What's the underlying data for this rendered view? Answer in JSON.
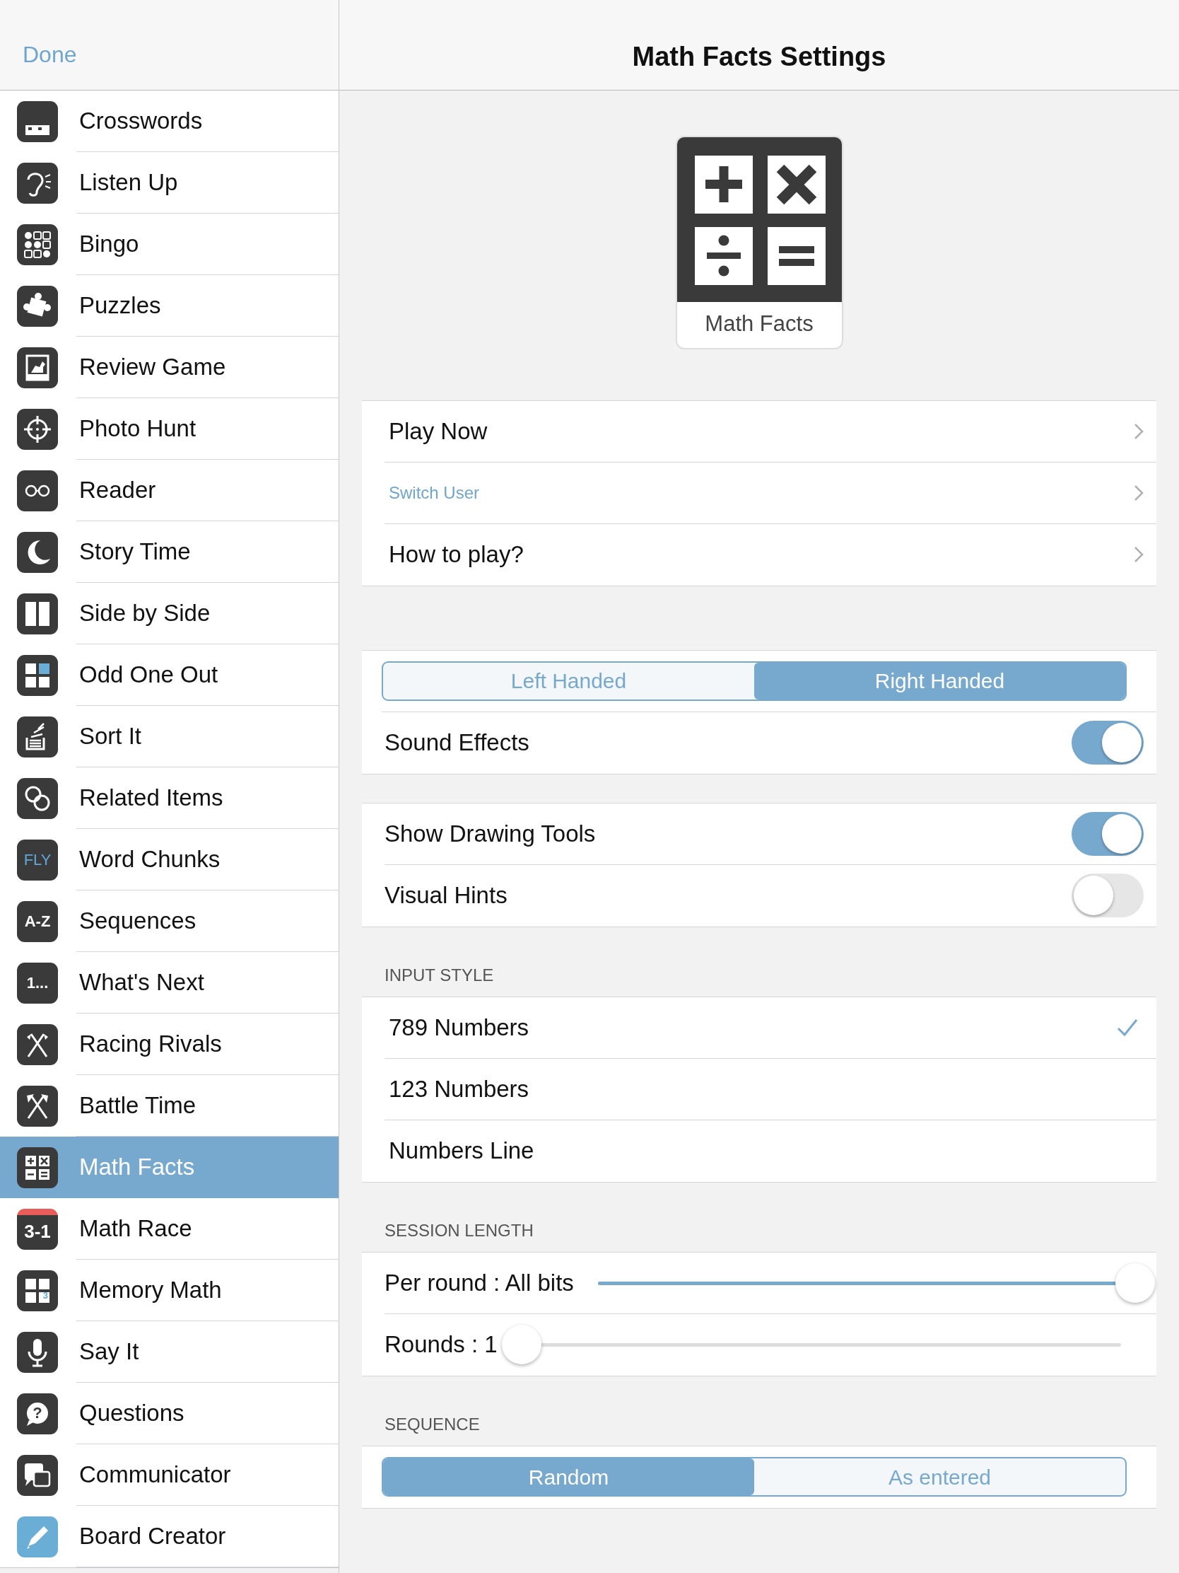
{
  "sidebar": {
    "done_button": "Done",
    "items": [
      {
        "label": "Crosswords",
        "selected": false
      },
      {
        "label": "Listen Up",
        "selected": false
      },
      {
        "label": "Bingo",
        "selected": false
      },
      {
        "label": "Puzzles",
        "selected": false
      },
      {
        "label": "Review Game",
        "selected": false
      },
      {
        "label": "Photo Hunt",
        "selected": false
      },
      {
        "label": "Reader",
        "selected": false
      },
      {
        "label": "Story Time",
        "selected": false
      },
      {
        "label": "Side by Side",
        "selected": false
      },
      {
        "label": "Odd One Out",
        "selected": false
      },
      {
        "label": "Sort It",
        "selected": false
      },
      {
        "label": "Related Items",
        "selected": false
      },
      {
        "label": "Word Chunks",
        "selected": false,
        "icon_text": "FLY"
      },
      {
        "label": "Sequences",
        "selected": false,
        "icon_text": "A-Z"
      },
      {
        "label": "What's Next",
        "selected": false,
        "icon_text": "1..."
      },
      {
        "label": "Racing Rivals",
        "selected": false
      },
      {
        "label": "Battle Time",
        "selected": false
      },
      {
        "label": "Math Facts",
        "selected": true
      },
      {
        "label": "Math Race",
        "selected": false,
        "icon_text": "3-1"
      },
      {
        "label": "Memory Math",
        "selected": false,
        "icon_text": "3"
      },
      {
        "label": "Say It",
        "selected": false
      },
      {
        "label": "Questions",
        "selected": false,
        "icon_text": "?"
      },
      {
        "label": "Communicator",
        "selected": false
      },
      {
        "label": "Board Creator",
        "selected": false
      }
    ]
  },
  "header": {
    "title": "Math Facts Settings"
  },
  "app_tile": {
    "label": "Math Facts"
  },
  "actions": [
    {
      "label": "Play Now",
      "kind": "primary"
    },
    {
      "label": "Switch User",
      "kind": "link"
    },
    {
      "label": "How to play?",
      "kind": "primary"
    }
  ],
  "hand_segment": [
    {
      "label": "Left Handed",
      "selected": false
    },
    {
      "label": "Right Handed",
      "selected": true
    }
  ],
  "sound_effects": {
    "label": "Sound Effects",
    "on": true
  },
  "drawing_switches": [
    {
      "label": "Show Drawing Tools",
      "on": true
    },
    {
      "label": "Visual Hints",
      "on": false
    }
  ],
  "input_style": {
    "heading": "INPUT STYLE",
    "options": [
      {
        "label": "789 Numbers",
        "selected": true
      },
      {
        "label": "123 Numbers",
        "selected": false
      },
      {
        "label": "Numbers Line",
        "selected": false
      }
    ]
  },
  "session_length": {
    "heading": "SESSION LENGTH",
    "sliders": [
      {
        "label": "Per round : All bits",
        "level": 1
      },
      {
        "label": "Rounds : 1",
        "level": 0
      }
    ]
  },
  "sequence": {
    "heading": "SEQUENCE",
    "options": [
      {
        "label": "Random",
        "selected": true
      },
      {
        "label": "As entered",
        "selected": false
      }
    ]
  }
}
